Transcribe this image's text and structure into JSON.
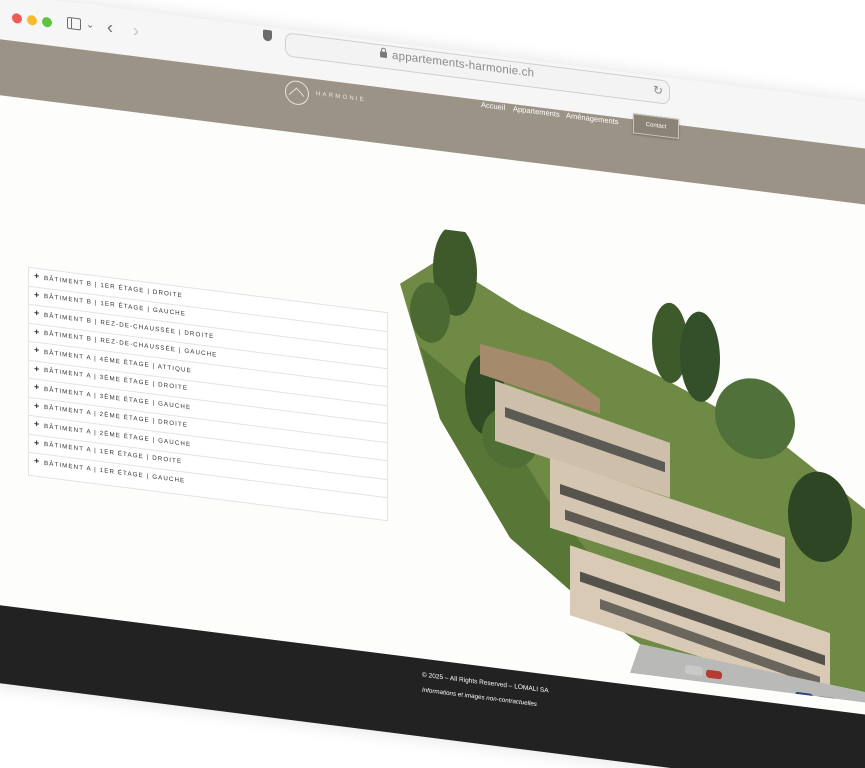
{
  "browser": {
    "url": "appartements-harmonie.ch"
  },
  "site": {
    "brand": "HARMONIE",
    "nav": {
      "accueil": "Accueil",
      "appartements": "Appartements",
      "amenagements": "Aménagements",
      "contact": "Contact"
    }
  },
  "apartments": [
    "BÂTIMENT B | 1ER ÉTAGE | DROITE",
    "BÂTIMENT B | 1ER ÉTAGE | GAUCHE",
    "BÂTIMENT B | REZ-DE-CHAUSSÉE | DROITE",
    "BÂTIMENT B | REZ-DE-CHAUSSÉE | GAUCHE",
    "BÂTIMENT A | 4ÈME ÉTAGE | ATTIQUE",
    "BÂTIMENT A | 3ÈME ÉTAGE | DROITE",
    "BÂTIMENT A | 3ÈME ÉTAGE | GAUCHE",
    "BÂTIMENT A | 2ÈME ÉTAGE | DROITE",
    "BÂTIMENT A | 2ÈME ÉTAGE | GAUCHE",
    "BÂTIMENT A | 1ER ÉTAGE | DROITE",
    "BÂTIMENT A | 1ER ÉTAGE | GAUCHE"
  ],
  "expand_symbol": "+",
  "footer": {
    "copyright": "© 2025 – All Rights Reserved – LOMALI SA",
    "disclaimer": "Informations et images non-contractuelles"
  },
  "colors": {
    "header": "#9b9385",
    "footer": "#222222",
    "page": "#fdfdfc"
  }
}
